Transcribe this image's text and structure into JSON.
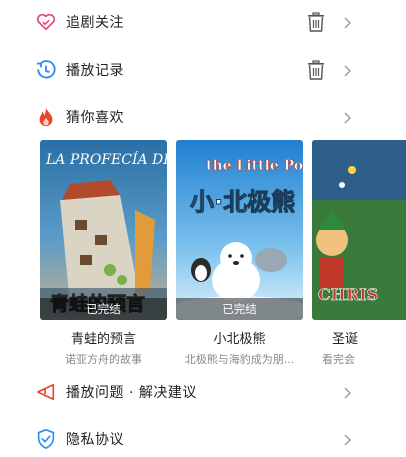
{
  "menu": {
    "follow": {
      "label": "追剧关注"
    },
    "history": {
      "label": "播放记录"
    },
    "guess": {
      "label": "猜你喜欢"
    },
    "feedback": {
      "label": "播放问题 · 解决建议"
    },
    "privacy": {
      "label": "隐私协议"
    }
  },
  "recommendations": [
    {
      "title": "青蛙的预言",
      "subtitle": "诺亚方舟的故事",
      "badge": "已完结",
      "poster_text": "LA PROFECÍA DE LAS RANAS",
      "poster_overlay": "青蛙的预言"
    },
    {
      "title": "小北极熊",
      "subtitle": "北极熊与海豹成为朋...",
      "badge": "已完结",
      "poster_text": "the Little Polar Bear",
      "poster_overlay": "小·北极熊"
    },
    {
      "title": "圣诞",
      "subtitle": "看完会",
      "badge": "",
      "poster_text": "CHRIS"
    }
  ],
  "colors": {
    "accent_pink": "#e5457a",
    "accent_blue": "#2c8ef0",
    "accent_red": "#e8472b",
    "icon_gray": "#666666",
    "chevron": "#9a9a9a"
  }
}
